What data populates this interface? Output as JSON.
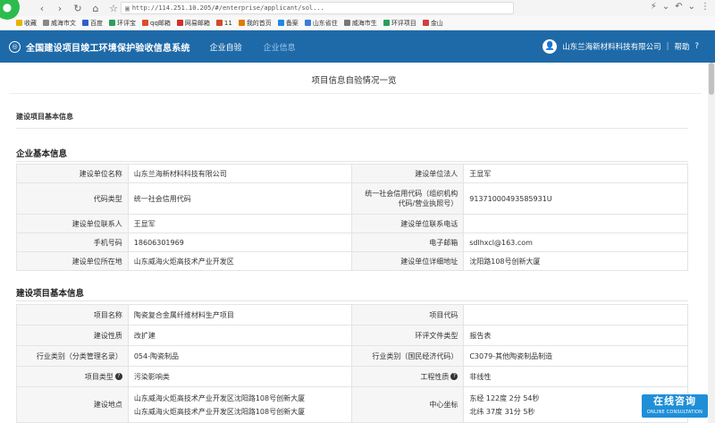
{
  "browser": {
    "url": "http://114.251.10.205/#/enterprise/applicant/sol...",
    "bookmarks": [
      "收藏",
      "威海市文",
      "百度",
      "环评宝",
      "qq邮箱",
      "网易邮箱",
      "11",
      "我的首页",
      "备案",
      "山东省住",
      "威海市生",
      "环评项目",
      "金山"
    ],
    "bookmark_colors": [
      "#e6b400",
      "#888888",
      "#2f5fd0",
      "#2aa05a",
      "#e04a2e",
      "#d32f2f",
      "#d14b2b",
      "#e07b00",
      "#1e88e5",
      "#3d7bd9",
      "#777777",
      "#2aa05a",
      "#d13f3f"
    ]
  },
  "header": {
    "title": "全国建设项目竣工环境保护验收信息系统",
    "nav": [
      "企业自验",
      "企业信息"
    ],
    "company": "山东兰海新材料科技有限公司",
    "help": "帮助"
  },
  "page": {
    "title": "项目信息自验情况一览",
    "section_top": "建设项目基本信息",
    "enterprise_section": "企业基本信息",
    "project_section": "建设项目基本信息"
  },
  "enterprise": {
    "rows": [
      [
        "建设单位名称",
        "山东兰海新材料科技有限公司",
        "建设单位法人",
        "王显军"
      ],
      [
        "代码类型",
        "统一社会信用代码",
        "统一社会信用代码（组织机构代码/营业执照号）",
        "91371000493585931U"
      ],
      [
        "建设单位联系人",
        "王显军",
        "建设单位联系电话",
        ""
      ],
      [
        "手机号码",
        "18606301969",
        "电子邮箱",
        "sdlhxcl@163.com"
      ],
      [
        "建设单位所在地",
        "山东威海火炬高技术产业开发区",
        "建设单位详细地址",
        "沈阳路108号创新大厦"
      ]
    ]
  },
  "project": {
    "rows": [
      [
        "项目名称",
        "陶瓷复合金属纤维材料生产项目",
        "项目代码",
        ""
      ],
      [
        "建设性质",
        "改扩建",
        "环评文件类型",
        "报告表"
      ],
      [
        "行业类别（分类管理名录）",
        "054-陶瓷制品",
        "行业类别（国民经济代码）",
        "C3079-其他陶瓷制品制造"
      ],
      [
        "项目类型",
        "污染影响类",
        "工程性质",
        "非线性"
      ]
    ],
    "location_label": "建设地点",
    "locations": [
      "山东威海火炬高技术产业开发区沈阳路108号创新大厦",
      "山东威海火炬高技术产业开发区沈阳路108号创新大厦"
    ],
    "coord_label": "中心坐标",
    "coords": [
      "东经 122度 2分 54秒",
      "北纬 37度 31分 5秒"
    ]
  },
  "chat": {
    "main": "在线咨询",
    "sub": "ONLINE CONSULTATION"
  }
}
